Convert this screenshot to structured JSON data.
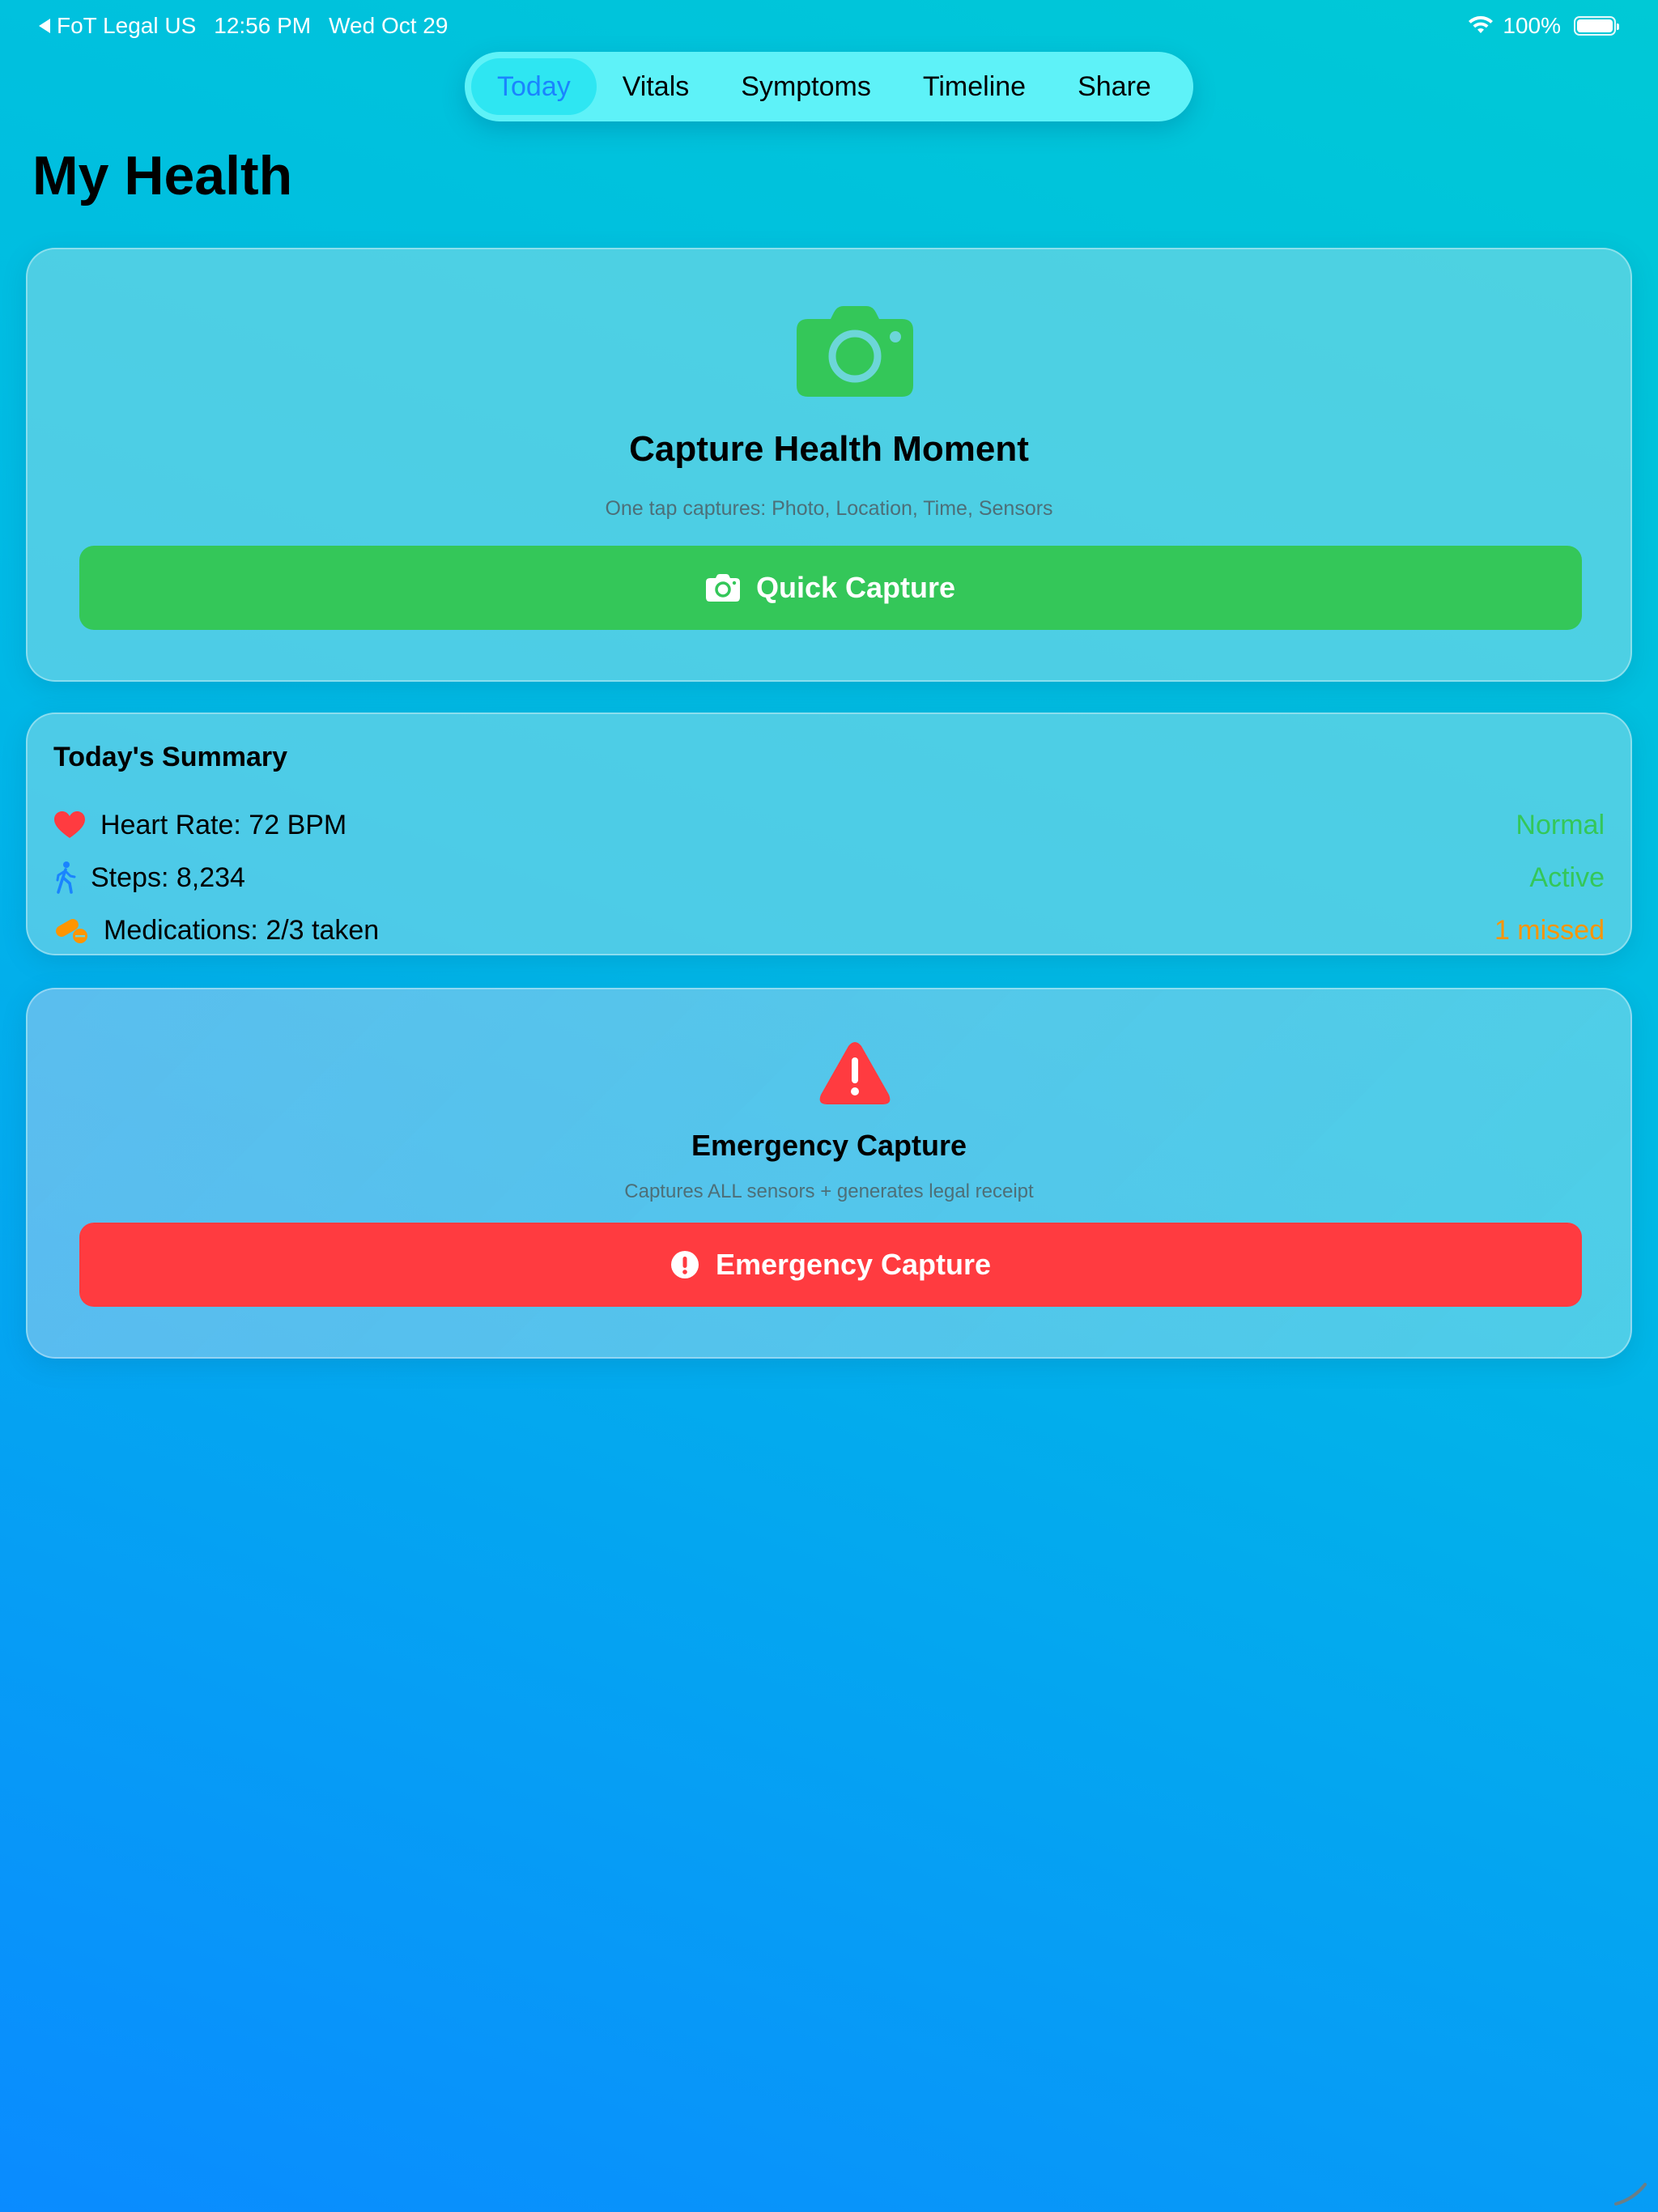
{
  "status_bar": {
    "back_app": "FoT Legal US",
    "time": "12:56 PM",
    "date": "Wed Oct 29",
    "battery": "100%"
  },
  "tabs": [
    {
      "label": "Today",
      "active": true
    },
    {
      "label": "Vitals",
      "active": false
    },
    {
      "label": "Symptoms",
      "active": false
    },
    {
      "label": "Timeline",
      "active": false
    },
    {
      "label": "Share",
      "active": false
    }
  ],
  "page": {
    "title": "My Health"
  },
  "capture_card": {
    "icon": "camera-icon",
    "title": "Capture Health Moment",
    "subtitle": "One tap captures: Photo, Location, Time, Sensors",
    "button_label": "Quick Capture"
  },
  "summary": {
    "title": "Today's Summary",
    "rows": [
      {
        "icon": "heart-icon",
        "label": "Heart Rate: 72 BPM",
        "status": "Normal",
        "status_color": "#34c759"
      },
      {
        "icon": "walking-figure-icon",
        "label": "Steps: 8,234",
        "status": "Active",
        "status_color": "#34c759"
      },
      {
        "icon": "pills-icon",
        "label": "Medications: 2/3 taken",
        "status": "1 missed",
        "status_color": "#ff9500"
      }
    ]
  },
  "emergency_card": {
    "icon": "warning-triangle-icon",
    "title": "Emergency Capture",
    "subtitle": "Captures ALL sensors + generates legal receipt",
    "button_label": "Emergency Capture"
  },
  "colors": {
    "accent_blue": "#1a84ff",
    "green": "#34c759",
    "red": "#ff3b40",
    "orange": "#ff9500"
  }
}
